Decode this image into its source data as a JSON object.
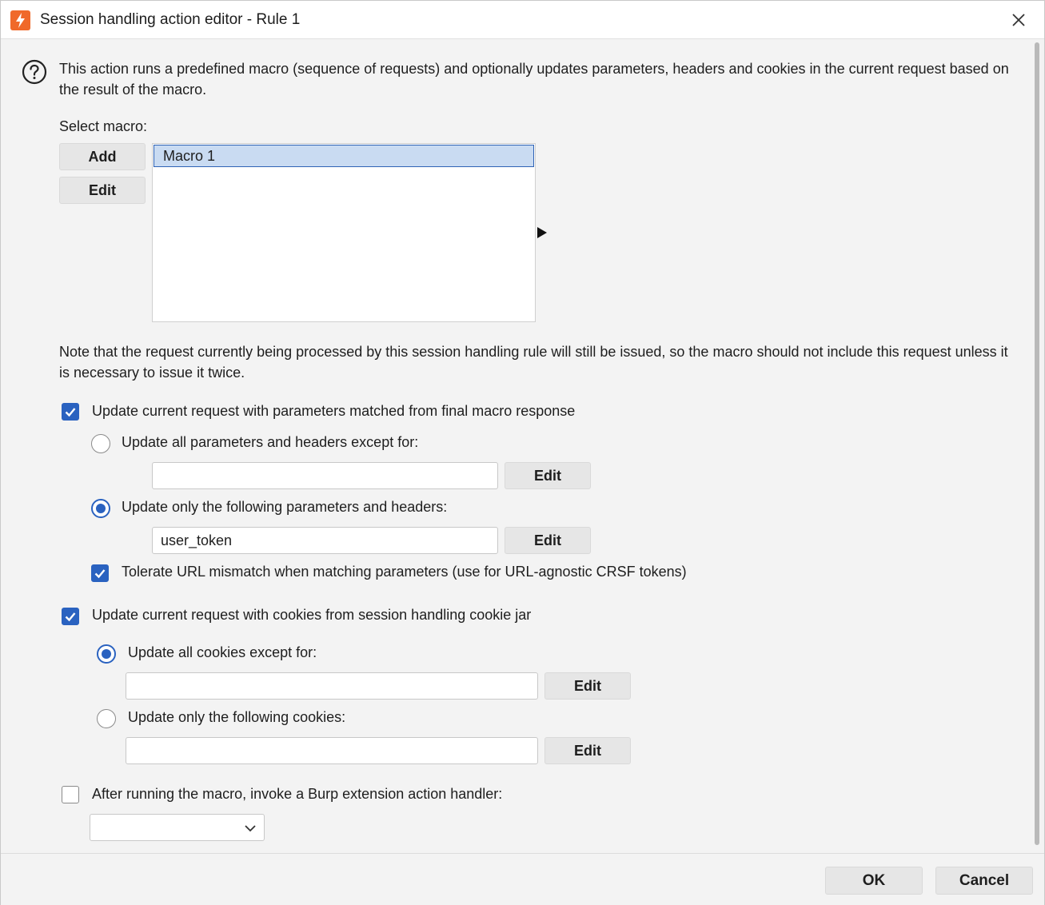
{
  "window": {
    "title": "Session handling action editor - Rule 1"
  },
  "description": "This action runs a predefined macro (sequence of requests) and optionally updates parameters, headers and cookies in the current request based on the result of the macro.",
  "macro": {
    "label": "Select macro:",
    "add_label": "Add",
    "edit_label": "Edit",
    "items": [
      "Macro 1"
    ],
    "selected": "Macro 1"
  },
  "note": "Note that the request currently being processed by this session handling rule will still be issued, so the macro should not include this request unless it is necessary to issue it twice.",
  "params": {
    "update_label": "Update current request with parameters matched from final macro response",
    "update_checked": true,
    "all_except_label": "Update all parameters and headers except for:",
    "all_except_selected": false,
    "all_except_value": "",
    "only_label": "Update only the following parameters and headers:",
    "only_selected": true,
    "only_value": "user_token",
    "edit_label": "Edit",
    "tolerate_label": "Tolerate URL mismatch when matching parameters (use for URL-agnostic CRSF tokens)",
    "tolerate_checked": true
  },
  "cookies": {
    "update_label": "Update current request with cookies from session handling cookie jar",
    "update_checked": true,
    "all_except_label": "Update all cookies except for:",
    "all_except_selected": true,
    "all_except_value": "",
    "only_label": "Update only the following cookies:",
    "only_selected": false,
    "only_value": "",
    "edit_label": "Edit"
  },
  "extension": {
    "label": "After running the macro, invoke a Burp extension action handler:",
    "checked": false,
    "selected_value": ""
  },
  "footer": {
    "ok_label": "OK",
    "cancel_label": "Cancel"
  },
  "colors": {
    "accent": "#2a62c0",
    "selection": "#c9dbf2",
    "brand": "#f0692a"
  }
}
